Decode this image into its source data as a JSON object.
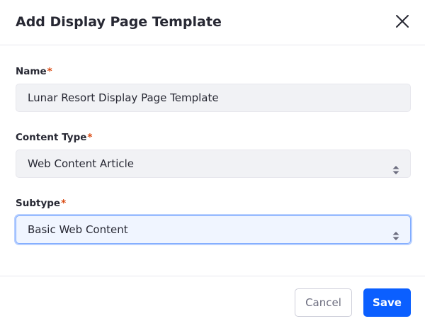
{
  "dialog": {
    "title": "Add Display Page Template",
    "close_icon": "close-icon"
  },
  "fields": {
    "name": {
      "label": "Name",
      "required_marker": "*",
      "value": "Lunar Resort Display Page Template"
    },
    "content_type": {
      "label": "Content Type",
      "required_marker": "*",
      "value": "Web Content Article",
      "icon": "select-caret-icon"
    },
    "subtype": {
      "label": "Subtype",
      "required_marker": "*",
      "value": "Basic Web Content",
      "icon": "select-caret-icon",
      "focused": true
    }
  },
  "footer": {
    "cancel_label": "Cancel",
    "save_label": "Save"
  },
  "colors": {
    "primary": "#0b5fff",
    "required": "#d9480f",
    "text": "#272833",
    "input_bg": "#f1f2f5",
    "focus_border": "#80acff"
  }
}
